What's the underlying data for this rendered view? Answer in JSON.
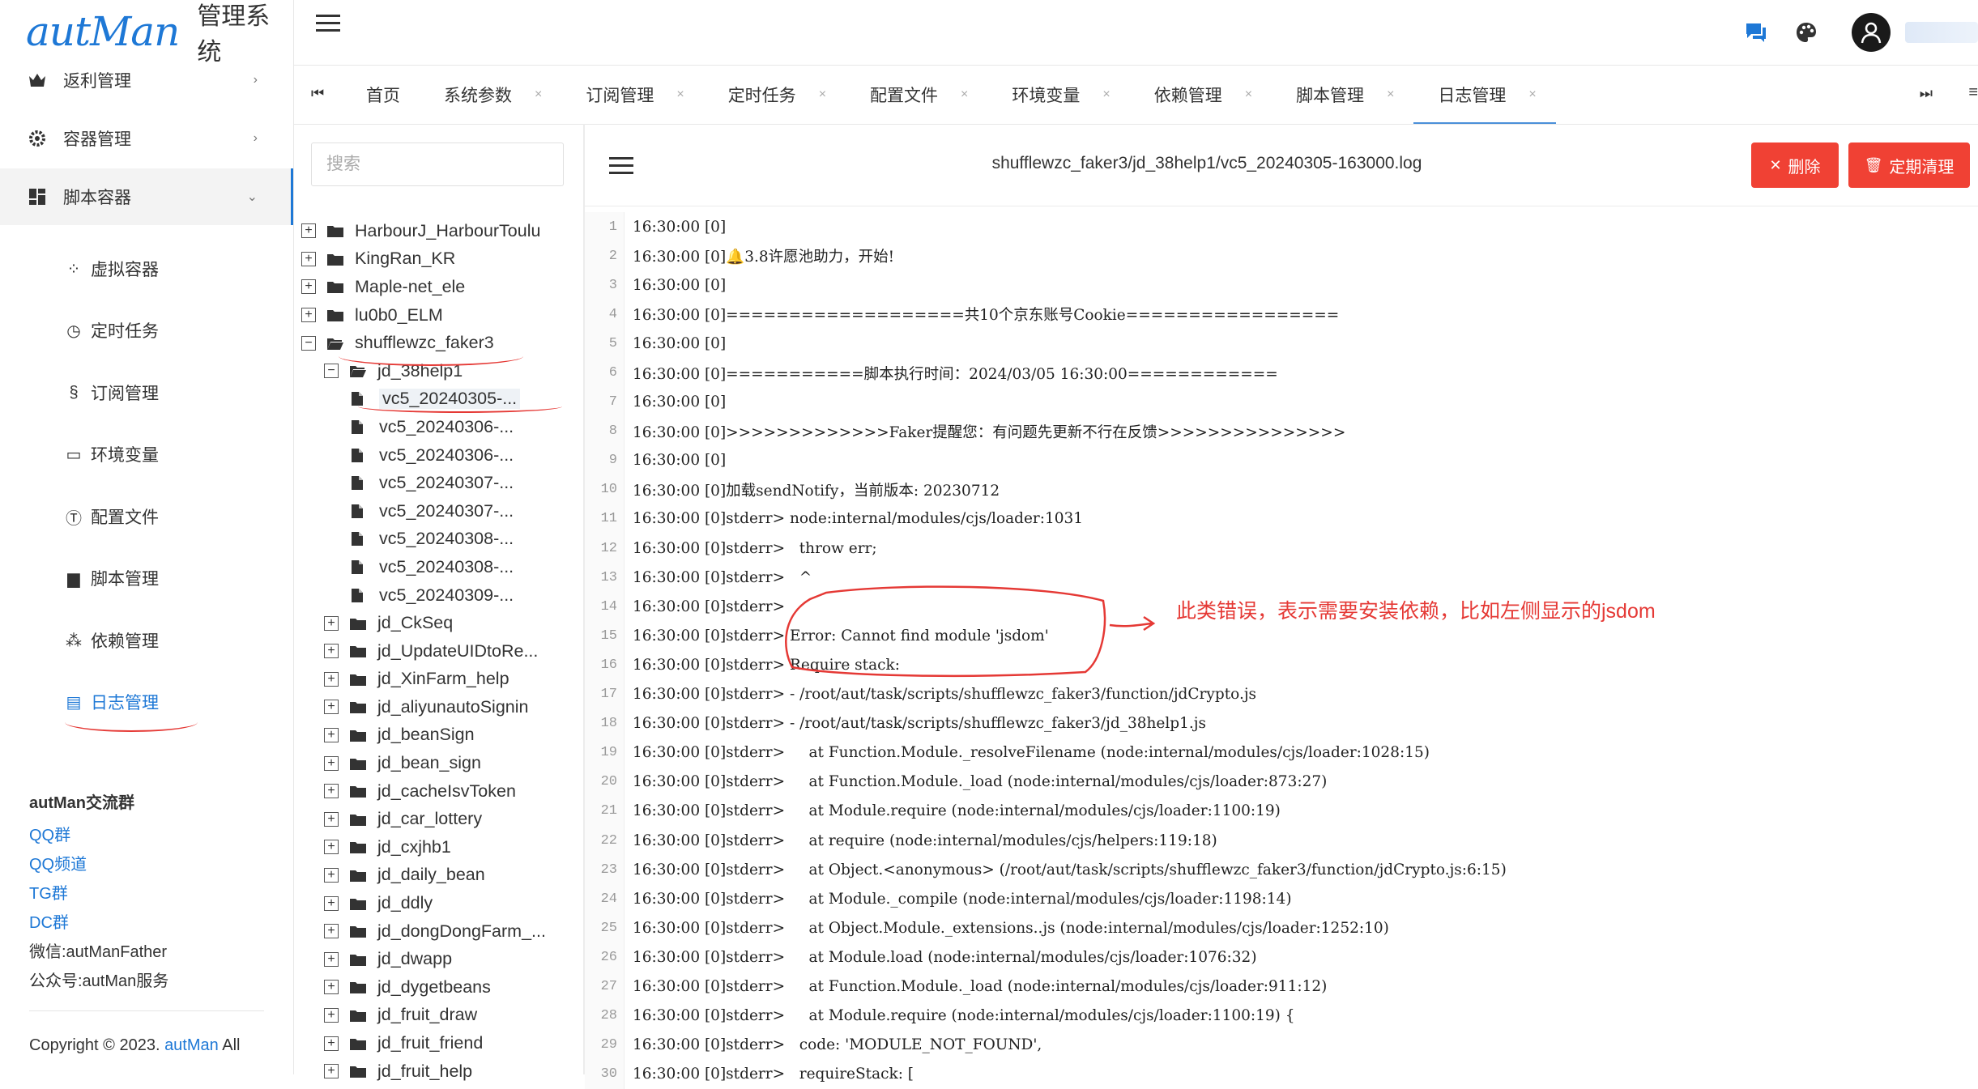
{
  "app": {
    "logo_word": "autMan",
    "logo_sub": "管理系统"
  },
  "sidebar": {
    "menus": [
      {
        "label": "返利管理",
        "icon": "crown-icon",
        "chevron": "›"
      },
      {
        "label": "容器管理",
        "icon": "gear-icon",
        "chevron": "›"
      },
      {
        "label": "脚本容器",
        "icon": "dashboard-icon",
        "chevron": "⌄"
      }
    ],
    "subs": [
      {
        "label": "虚拟容器",
        "icon": "apps-icon",
        "glyph": "⁘"
      },
      {
        "label": "定时任务",
        "icon": "calendar-clock-icon",
        "glyph": "◷"
      },
      {
        "label": "订阅管理",
        "icon": "section-icon",
        "glyph": "§"
      },
      {
        "label": "环境变量",
        "icon": "monitor-icon",
        "glyph": "▭"
      },
      {
        "label": "配置文件",
        "icon": "tc-icon",
        "glyph": "Ⓣ"
      },
      {
        "label": "脚本管理",
        "icon": "script-icon",
        "glyph": "▆"
      },
      {
        "label": "依赖管理",
        "icon": "dependency-icon",
        "glyph": "⁂"
      },
      {
        "label": "日志管理",
        "icon": "document-icon",
        "glyph": "▤"
      }
    ],
    "community": {
      "title": "autMan交流群",
      "links": [
        "QQ群",
        "QQ频道",
        "TG群",
        "DC群"
      ],
      "texts": [
        "微信:autManFather",
        "公众号:autMan服务"
      ]
    },
    "copyright": {
      "prefix": "Copyright © 2023. ",
      "link": "autMan",
      "suffix": " All"
    }
  },
  "tabs": {
    "nav_left": "⏮",
    "nav_right": "⏭",
    "menu": "≡",
    "items": [
      {
        "label": "首页",
        "closable": false
      },
      {
        "label": "系统参数",
        "closable": true
      },
      {
        "label": "订阅管理",
        "closable": true
      },
      {
        "label": "定时任务",
        "closable": true
      },
      {
        "label": "配置文件",
        "closable": true
      },
      {
        "label": "环境变量",
        "closable": true
      },
      {
        "label": "依赖管理",
        "closable": true
      },
      {
        "label": "脚本管理",
        "closable": true
      },
      {
        "label": "日志管理",
        "closable": true,
        "active": true
      }
    ],
    "close_glyph": "×"
  },
  "tree": {
    "search_placeholder": "搜索",
    "nodes": [
      {
        "label": "HarbourJ_HarbourToulu",
        "depth": 0,
        "type": "folder",
        "toggle": "+"
      },
      {
        "label": "KingRan_KR",
        "depth": 0,
        "type": "folder",
        "toggle": "+"
      },
      {
        "label": "Maple-net_ele",
        "depth": 0,
        "type": "folder",
        "toggle": "+"
      },
      {
        "label": "lu0b0_ELM",
        "depth": 0,
        "type": "folder",
        "toggle": "+"
      },
      {
        "label": "shufflewzc_faker3",
        "depth": 0,
        "type": "folder-open",
        "toggle": "−"
      },
      {
        "label": "jd_38help1",
        "depth": 1,
        "type": "folder-open",
        "toggle": "−"
      },
      {
        "label": "vc5_20240305-...",
        "depth": 2,
        "type": "file",
        "selected": true
      },
      {
        "label": "vc5_20240306-...",
        "depth": 2,
        "type": "file"
      },
      {
        "label": "vc5_20240306-...",
        "depth": 2,
        "type": "file"
      },
      {
        "label": "vc5_20240307-...",
        "depth": 2,
        "type": "file"
      },
      {
        "label": "vc5_20240307-...",
        "depth": 2,
        "type": "file"
      },
      {
        "label": "vc5_20240308-...",
        "depth": 2,
        "type": "file"
      },
      {
        "label": "vc5_20240308-...",
        "depth": 2,
        "type": "file"
      },
      {
        "label": "vc5_20240309-...",
        "depth": 2,
        "type": "file"
      },
      {
        "label": "jd_CkSeq",
        "depth": 1,
        "type": "folder",
        "toggle": "+"
      },
      {
        "label": "jd_UpdateUIDtoRe...",
        "depth": 1,
        "type": "folder",
        "toggle": "+"
      },
      {
        "label": "jd_XinFarm_help",
        "depth": 1,
        "type": "folder",
        "toggle": "+"
      },
      {
        "label": "jd_aliyunautoSignin",
        "depth": 1,
        "type": "folder",
        "toggle": "+"
      },
      {
        "label": "jd_beanSign",
        "depth": 1,
        "type": "folder",
        "toggle": "+"
      },
      {
        "label": "jd_bean_sign",
        "depth": 1,
        "type": "folder",
        "toggle": "+"
      },
      {
        "label": "jd_cacheIsvToken",
        "depth": 1,
        "type": "folder",
        "toggle": "+"
      },
      {
        "label": "jd_car_lottery",
        "depth": 1,
        "type": "folder",
        "toggle": "+"
      },
      {
        "label": "jd_cxjhb1",
        "depth": 1,
        "type": "folder",
        "toggle": "+"
      },
      {
        "label": "jd_daily_bean",
        "depth": 1,
        "type": "folder",
        "toggle": "+"
      },
      {
        "label": "jd_ddly",
        "depth": 1,
        "type": "folder",
        "toggle": "+"
      },
      {
        "label": "jd_dongDongFarm_...",
        "depth": 1,
        "type": "folder",
        "toggle": "+"
      },
      {
        "label": "jd_dwapp",
        "depth": 1,
        "type": "folder",
        "toggle": "+"
      },
      {
        "label": "jd_dygetbeans",
        "depth": 1,
        "type": "folder",
        "toggle": "+"
      },
      {
        "label": "jd_fruit_draw",
        "depth": 1,
        "type": "folder",
        "toggle": "+"
      },
      {
        "label": "jd_fruit_friend",
        "depth": 1,
        "type": "folder",
        "toggle": "+"
      },
      {
        "label": "jd_fruit_help",
        "depth": 1,
        "type": "folder",
        "toggle": "+"
      }
    ]
  },
  "log": {
    "title": "shufflewzc_faker3/jd_38help1/vc5_20240305-163000.log",
    "delete_label": "删除",
    "delete_glyph": "✕",
    "clean_label": "定期清理",
    "clean_glyph": "🗑",
    "lines": [
      "16:30:00 [0]",
      "16:30:00 [0]🔔3.8许愿池助力，开始!",
      "16:30:00 [0]",
      "16:30:00 [0]===================共10个京东账号Cookie=================",
      "16:30:00 [0]",
      "16:30:00 [0]===========脚本执行时间：2024/03/05 16:30:00============",
      "16:30:00 [0]",
      "16:30:00 [0]>>>>>>>>>>>>>Faker提醒您：有问题先更新不行在反馈>>>>>>>>>>>>>>>",
      "16:30:00 [0]",
      "16:30:00 [0]加载sendNotify，当前版本: 20230712",
      "16:30:00 [0]stderr> node:internal/modules/cjs/loader:1031",
      "16:30:00 [0]stderr>   throw err;",
      "16:30:00 [0]stderr>   ^",
      "16:30:00 [0]stderr>",
      "16:30:00 [0]stderr> Error: Cannot find module 'jsdom'",
      "16:30:00 [0]stderr> Require stack:",
      "16:30:00 [0]stderr> - /root/aut/task/scripts/shufflewzc_faker3/function/jdCrypto.js",
      "16:30:00 [0]stderr> - /root/aut/task/scripts/shufflewzc_faker3/jd_38help1.js",
      "16:30:00 [0]stderr>     at Function.Module._resolveFilename (node:internal/modules/cjs/loader:1028:15)",
      "16:30:00 [0]stderr>     at Function.Module._load (node:internal/modules/cjs/loader:873:27)",
      "16:30:00 [0]stderr>     at Module.require (node:internal/modules/cjs/loader:1100:19)",
      "16:30:00 [0]stderr>     at require (node:internal/modules/cjs/helpers:119:18)",
      "16:30:00 [0]stderr>     at Object.<anonymous> (/root/aut/task/scripts/shufflewzc_faker3/function/jdCrypto.js:6:15)",
      "16:30:00 [0]stderr>     at Module._compile (node:internal/modules/cjs/loader:1198:14)",
      "16:30:00 [0]stderr>     at Object.Module._extensions..js (node:internal/modules/cjs/loader:1252:10)",
      "16:30:00 [0]stderr>     at Module.load (node:internal/modules/cjs/loader:1076:32)",
      "16:30:00 [0]stderr>     at Function.Module._load (node:internal/modules/cjs/loader:911:12)",
      "16:30:00 [0]stderr>     at Module.require (node:internal/modules/cjs/loader:1100:19) {",
      "16:30:00 [0]stderr>   code: 'MODULE_NOT_FOUND',",
      "16:30:00 [0]stderr>   requireStack: ["
    ]
  },
  "annotation": {
    "text": "此类错误，表示需要安装依赖，比如左侧显示的jsdom",
    "color": "#e53935"
  },
  "colors": {
    "accent": "#1e78d6",
    "danger": "#f04134"
  }
}
